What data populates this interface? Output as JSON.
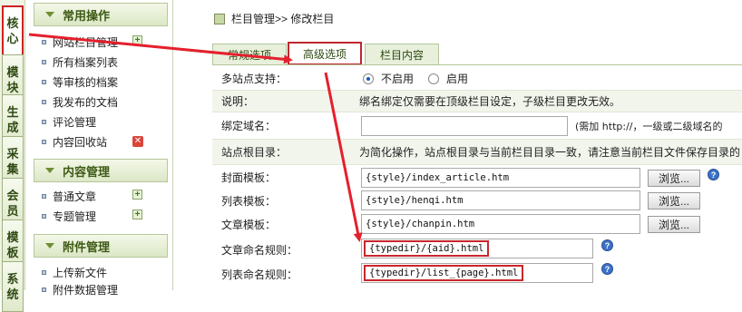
{
  "left_tabs": [
    "核\n心",
    "模\n块",
    "生\n成",
    "采\n集",
    "会\n员",
    "模\n板",
    "系\n统"
  ],
  "menu": {
    "groups": [
      {
        "title": "常用操作",
        "items": [
          "网站栏目管理",
          "所有档案列表",
          "等审核的档案",
          "我发布的文档",
          "评论管理",
          "内容回收站"
        ]
      },
      {
        "title": "内容管理",
        "items": [
          "普通文章",
          "专题管理"
        ]
      },
      {
        "title": "附件管理",
        "items": [
          "上传新文件",
          "附件数据管理"
        ]
      }
    ]
  },
  "breadcrumb": "栏目管理>> 修改栏目",
  "tabs": [
    "常规选项",
    "高级选项",
    "栏目内容"
  ],
  "form": {
    "multisite_label": "多站点支持：",
    "multisite_off": "不启用",
    "multisite_on": "启用",
    "note_label": "说明：",
    "note_text": "绑名绑定仅需要在顶级栏目设定，子级栏目更改无效。",
    "bind_domain_label": "绑定域名：",
    "bind_domain_hint": "(需加 http://，一级或二级域名的",
    "site_root_label": "站点根目录：",
    "site_root_text": "为简化操作，站点根目录与当前栏目目录一致，请注意当前栏目文件保存目录的",
    "cover_tpl_label": "封面模板：",
    "cover_tpl_value": "{style}/index_article.htm",
    "list_tpl_label": "列表模板：",
    "list_tpl_value": "{style}/henqi.htm",
    "article_tpl_label": "文章模板：",
    "article_tpl_value": "{style}/chanpin.htm",
    "article_rule_label": "文章命名规则：",
    "article_rule_value": "{typedir}/{aid}.html",
    "list_rule_label": "列表命名规则：",
    "list_rule_value": "{typedir}/list_{page}.html",
    "browse_label": "浏览..."
  },
  "colors": {
    "highlight": "#c8262c",
    "accent_green": "#3d5a14"
  }
}
